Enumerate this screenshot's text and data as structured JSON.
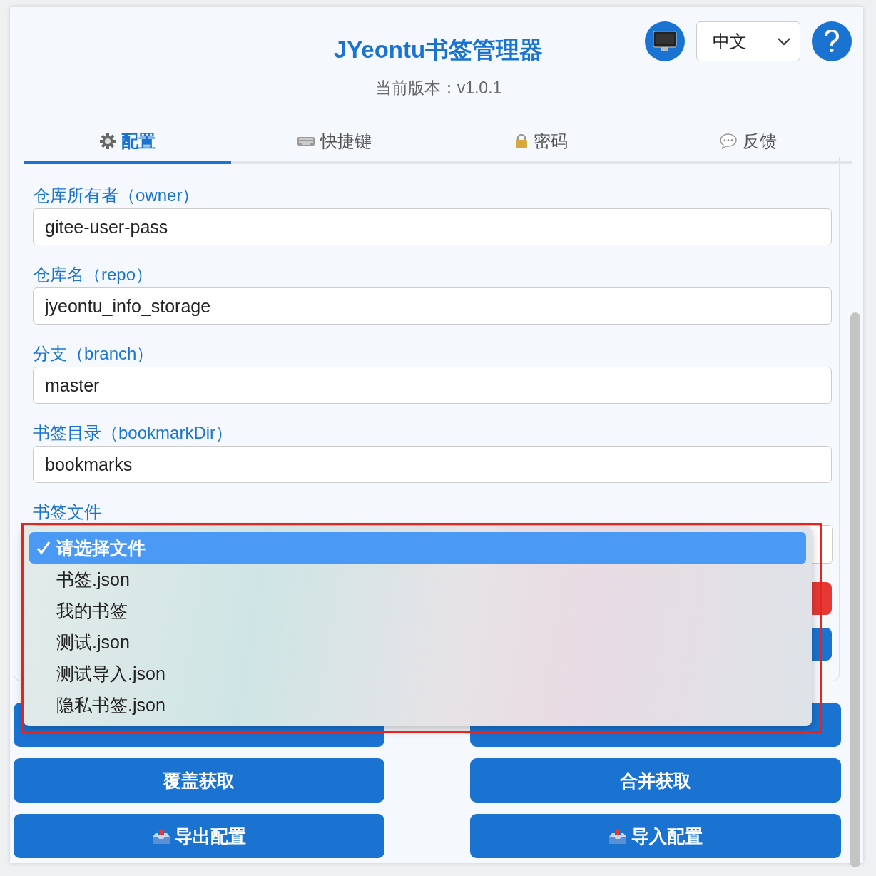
{
  "header": {
    "title": "JYeontu书签管理器",
    "version": "当前版本：v1.0.1",
    "language": "中文"
  },
  "tabs": [
    {
      "label": "配置",
      "kind": "gear",
      "selected": true
    },
    {
      "label": "快捷键",
      "kind": "keyboard",
      "selected": false
    },
    {
      "label": "密码",
      "kind": "lock",
      "selected": false
    },
    {
      "label": "反馈",
      "kind": "speech",
      "selected": false
    }
  ],
  "fields": [
    {
      "label": "仓库所有者（owner）",
      "value": "gitee-user-pass"
    },
    {
      "label": "仓库名（repo）",
      "value": "jyeontu_info_storage"
    },
    {
      "label": "分支（branch）",
      "value": "master"
    },
    {
      "label": "书签目录（bookmarkDir）",
      "value": "bookmarks"
    }
  ],
  "file_select": {
    "label": "书签文件",
    "options": [
      {
        "label": "请选择文件",
        "selected": true
      },
      {
        "label": "书签.json",
        "selected": false
      },
      {
        "label": "我的书签",
        "selected": false
      },
      {
        "label": "测试.json",
        "selected": false
      },
      {
        "label": "测试导入.json",
        "selected": false
      },
      {
        "label": "隐私书签.json",
        "selected": false
      }
    ]
  },
  "buttons": [
    {
      "label": "覆盖获取",
      "kind": "plain"
    },
    {
      "label": "合并获取",
      "kind": "plain"
    },
    {
      "label": "导出配置",
      "kind": "export"
    },
    {
      "label": "导入配置",
      "kind": "import"
    }
  ]
}
